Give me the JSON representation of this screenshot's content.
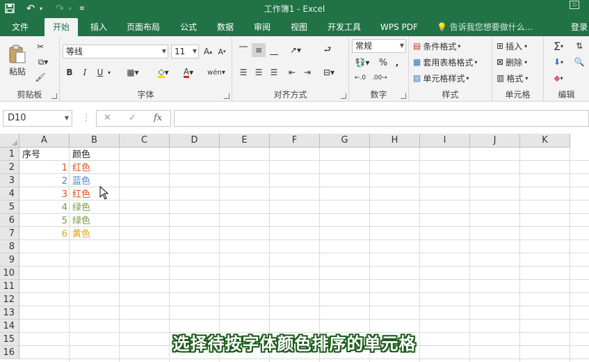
{
  "window": {
    "title": "工作簿1 - Excel"
  },
  "ribbon_tabs": [
    {
      "label": "文件"
    },
    {
      "label": "开始"
    },
    {
      "label": "插入"
    },
    {
      "label": "页面布局"
    },
    {
      "label": "公式"
    },
    {
      "label": "数据"
    },
    {
      "label": "审阅"
    },
    {
      "label": "视图"
    },
    {
      "label": "开发工具"
    },
    {
      "label": "WPS PDF"
    }
  ],
  "active_tab": "开始",
  "tell_me": "告诉我您想要做什么...",
  "sign_in": "登录",
  "ribbon": {
    "clipboard": {
      "paste": "粘贴",
      "label": "剪贴板"
    },
    "font": {
      "name": "等线",
      "size": "11",
      "label": "字体",
      "bold": "B",
      "italic": "I",
      "underline": "U",
      "phonetic": "wén"
    },
    "alignment": {
      "label": "对齐方式"
    },
    "number": {
      "format": "常规",
      "label": "数字",
      "percent": "%",
      "comma": ","
    },
    "styles": {
      "conditional": "条件格式",
      "table": "套用表格格式",
      "cell": "单元格样式",
      "label": "样式"
    },
    "cells": {
      "insert": "插入",
      "delete": "删除",
      "format": "格式",
      "label": "单元格"
    },
    "editing": {
      "label": "编辑"
    }
  },
  "formula_bar": {
    "name_box": "D10",
    "formula": ""
  },
  "sheet": {
    "columns": [
      "A",
      "B",
      "C",
      "D",
      "E",
      "F",
      "G",
      "H",
      "I",
      "J",
      "K"
    ],
    "rows": [
      "1",
      "2",
      "3",
      "4",
      "5",
      "6",
      "7",
      "8",
      "9",
      "10",
      "11",
      "12",
      "13",
      "14",
      "15",
      "16"
    ],
    "header": {
      "a": "序号",
      "b": "颜色"
    },
    "data": [
      {
        "num": "1",
        "color": "红色",
        "hex": "#d9521b"
      },
      {
        "num": "2",
        "color": "蓝色",
        "hex": "#4a86c5"
      },
      {
        "num": "3",
        "color": "红色",
        "hex": "#d9521b"
      },
      {
        "num": "4",
        "color": "绿色",
        "hex": "#7a9a3e"
      },
      {
        "num": "5",
        "color": "绿色",
        "hex": "#7a9a3e"
      },
      {
        "num": "6",
        "color": "黄色",
        "hex": "#e0a020"
      }
    ]
  },
  "caption": "选择待按字体颜色排序的单元格",
  "colors": {
    "brand": "#217346",
    "caption_outline": "#1d5c1d"
  }
}
